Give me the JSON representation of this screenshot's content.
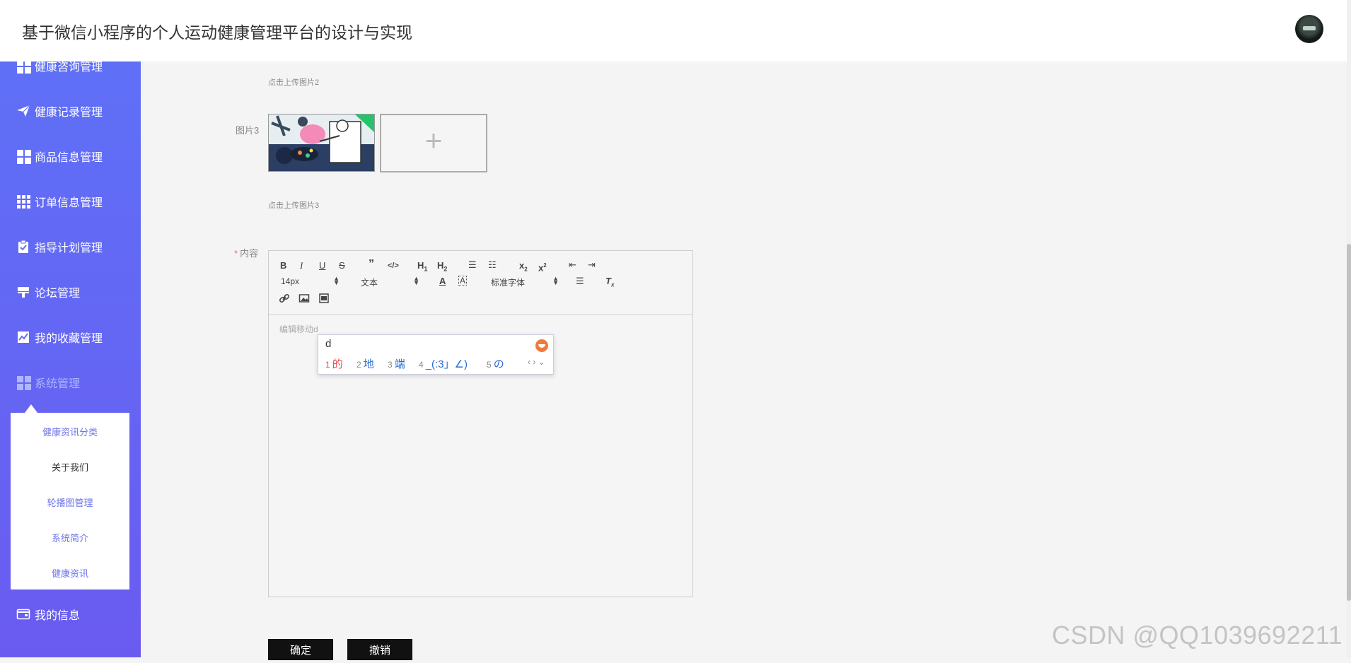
{
  "header": {
    "title": "基于微信小程序的个人运动健康管理平台的设计与实现"
  },
  "sidebar": {
    "partial_top_item": "健康咨询管理",
    "items": [
      {
        "label": "健康记录管理",
        "icon": "paper-plane-icon"
      },
      {
        "label": "商品信息管理",
        "icon": "grid-icon"
      },
      {
        "label": "订单信息管理",
        "icon": "grid-nine-icon"
      },
      {
        "label": "指导计划管理",
        "icon": "clipboard-check-icon"
      },
      {
        "label": "论坛管理",
        "icon": "flag-icon"
      },
      {
        "label": "我的收藏管理",
        "icon": "chart-icon"
      },
      {
        "label": "系统管理",
        "icon": "grid-icon"
      },
      {
        "label": "我的信息",
        "icon": "wallet-icon"
      }
    ],
    "submenu": [
      "健康资讯分类",
      "关于我们",
      "轮播图管理",
      "系统简介",
      "健康资讯"
    ]
  },
  "form": {
    "hint_image2": "点击上传图片2",
    "image3_label": "图片3",
    "upload_plus": "+",
    "hint_image3": "点击上传图片3",
    "content_required": "*",
    "content_label": "内容"
  },
  "editor": {
    "font_size": "14px",
    "block_format": "文本",
    "font_family": "标准字体",
    "placeholder": "编辑移动d"
  },
  "ime": {
    "input": "d",
    "candidates": [
      {
        "num": "1",
        "text": "的"
      },
      {
        "num": "2",
        "text": "地"
      },
      {
        "num": "3",
        "text": "端"
      },
      {
        "num": "4",
        "text": "_(:3」∠)"
      },
      {
        "num": "5",
        "text": "の"
      }
    ],
    "nav": "‹ › ⌄"
  },
  "buttons": {
    "confirm": "确定",
    "cancel": "撤销"
  },
  "watermark": "CSDN @QQ1039692211",
  "colors": {
    "sidebar_top": "#5f70f7",
    "sidebar_bottom": "#6a5bf0",
    "button": "#111111",
    "active_submenu": "#6b73e8"
  }
}
